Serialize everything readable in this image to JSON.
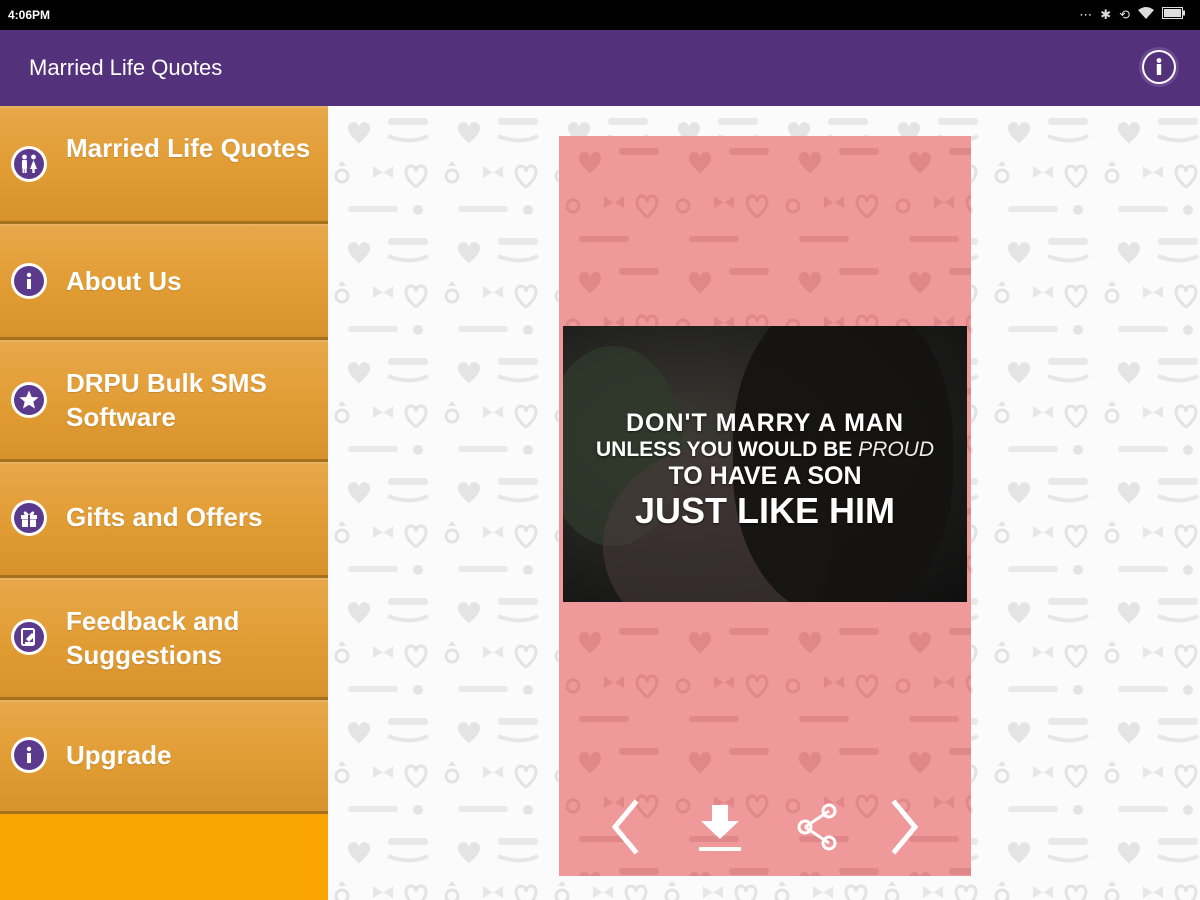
{
  "status_bar": {
    "time": "4:06PM"
  },
  "app_bar": {
    "title": "Married Life Quotes",
    "info_icon": "info-icon"
  },
  "sidebar": {
    "items": [
      {
        "label": "Married Life Quotes",
        "icon": "couple-icon"
      },
      {
        "label": "About Us",
        "icon": "info-icon"
      },
      {
        "label": "DRPU Bulk SMS Software",
        "icon": "star-icon"
      },
      {
        "label": "Gifts and Offers",
        "icon": "gift-icon"
      },
      {
        "label": "Feedback and Suggestions",
        "icon": "feedback-icon"
      },
      {
        "label": "Upgrade",
        "icon": "info-icon"
      }
    ]
  },
  "quote": {
    "line1": "DON'T MARRY A MAN",
    "line2_start": "UNLESS YOU WOULD BE ",
    "line2_emph": "PROUD",
    "line3": "TO HAVE A SON",
    "line4": "JUST LIKE HIM"
  },
  "controls": {
    "prev_icon": "chevron-left-icon",
    "download_icon": "download-icon",
    "share_icon": "share-icon",
    "next_icon": "chevron-right-icon"
  },
  "colors": {
    "app_bar": "#54317b",
    "sidebar": "#f9a400",
    "menu_item": "#e19c33",
    "card": "#f0999a"
  }
}
